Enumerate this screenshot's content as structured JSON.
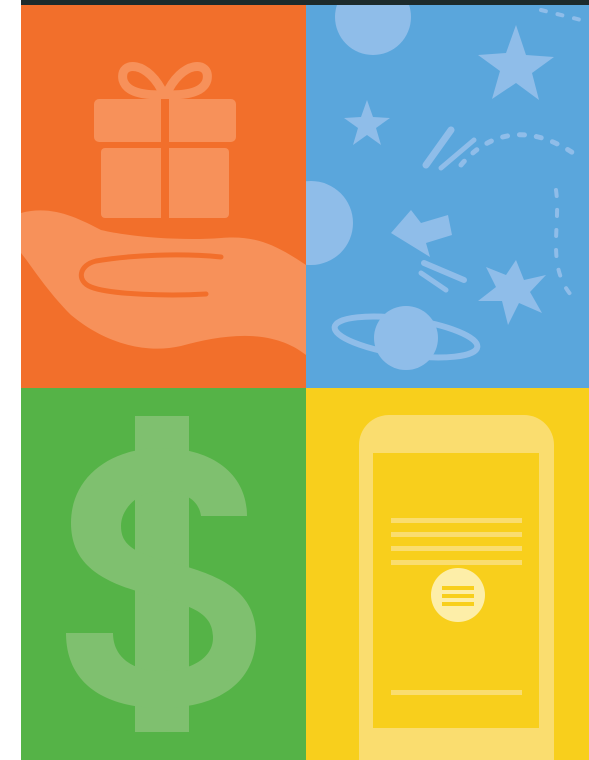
{
  "tiles": [
    {
      "id": "gift",
      "icon": "gift-in-hand-icon",
      "color": "#f26f2b"
    },
    {
      "id": "space",
      "icon": "space-stars-planets-icon",
      "color": "#5aa6dc"
    },
    {
      "id": "money",
      "icon": "dollar-sign-icon",
      "color": "#55b347"
    },
    {
      "id": "phone",
      "icon": "smartphone-icon",
      "color": "#f8cf1c"
    }
  ],
  "top_bar_color": "#1d2b2c"
}
